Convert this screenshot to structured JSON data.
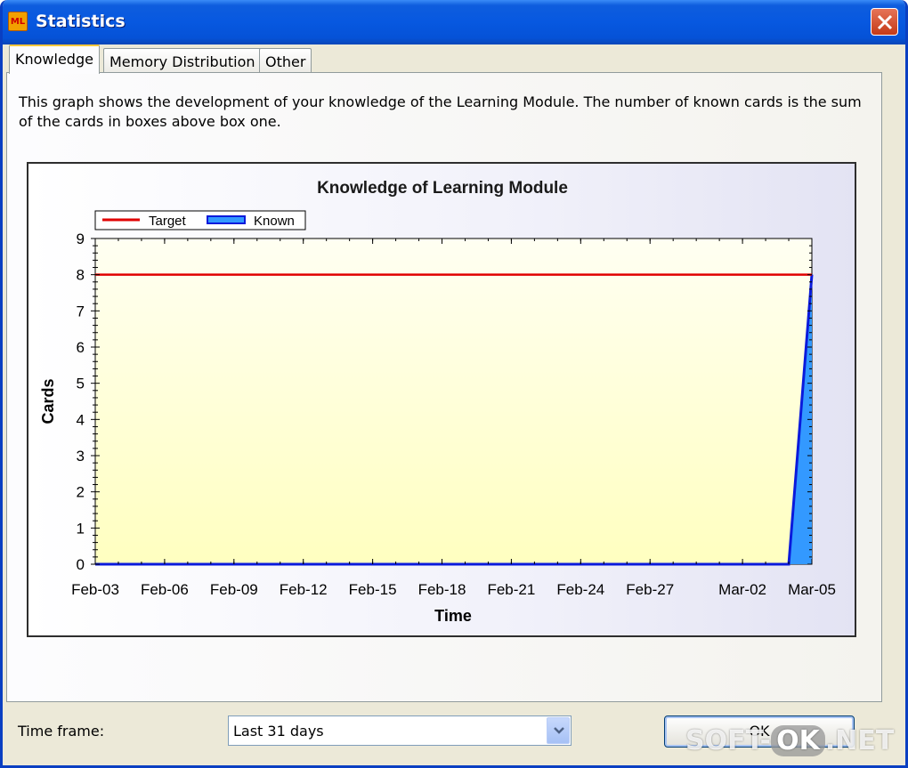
{
  "window": {
    "title": "Statistics",
    "app_icon_text": "ML"
  },
  "tabs": [
    {
      "label": "Knowledge",
      "active": true
    },
    {
      "label": "Memory Distribution",
      "active": false
    },
    {
      "label": "Other",
      "active": false
    }
  ],
  "description": "This graph shows the development of your knowledge of the Learning Module. The number of known cards is the sum of the cards in boxes above box one.",
  "chart_data": {
    "type": "area",
    "title": "Knowledge of Learning Module",
    "xlabel": "Time",
    "ylabel": "Cards",
    "ylim": [
      0,
      9
    ],
    "yticks": [
      "0",
      "1",
      "2",
      "3",
      "4",
      "5",
      "6",
      "7",
      "8",
      "9"
    ],
    "xticks": [
      "Feb-03",
      "Feb-06",
      "Feb-09",
      "Feb-12",
      "Feb-15",
      "Feb-18",
      "Feb-21",
      "Feb-24",
      "Feb-27",
      "Mar-02",
      "Mar-05"
    ],
    "legend_position": "top-left",
    "series": [
      {
        "name": "Target",
        "type": "line",
        "color": "#E00000",
        "points": [
          {
            "x": "Feb-03",
            "y": 8
          },
          {
            "x": "Mar-05",
            "y": 8
          }
        ]
      },
      {
        "name": "Known",
        "type": "area",
        "color": "#0A1ADC",
        "fill": "#3399FF",
        "points": [
          {
            "x": "Feb-03",
            "y": 0
          },
          {
            "x": "Mar-04",
            "y": 0
          },
          {
            "x": "Mar-05",
            "y": 8
          }
        ]
      }
    ]
  },
  "footer": {
    "timeframe_label": "Time frame:",
    "timeframe_value": "Last 31 days",
    "ok_label": "OK"
  },
  "watermark": {
    "prefix": "SOFT-",
    "pill": "OK",
    "suffix": ".NET"
  }
}
